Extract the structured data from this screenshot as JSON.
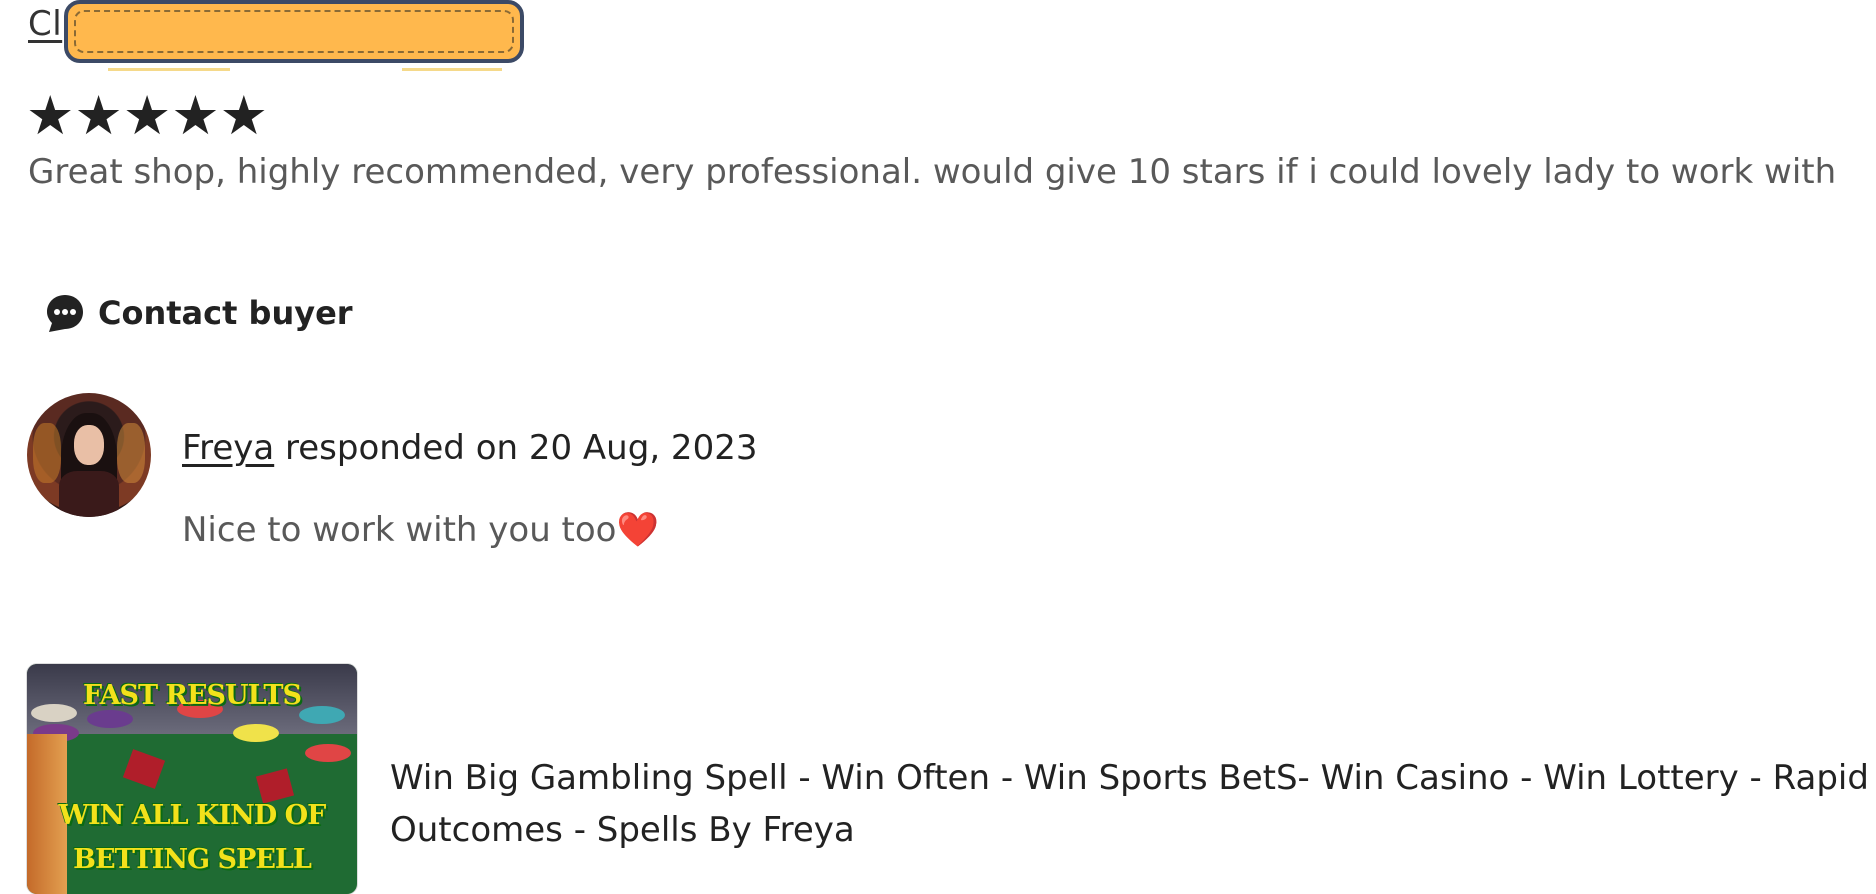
{
  "review": {
    "reviewer_name_visible": "Cl",
    "rating": 5,
    "stars": "★★★★★",
    "text": "Great shop, highly recommended, very professional. would give 10 stars if i could lovely lady to work with"
  },
  "contact": {
    "label": "Contact buyer",
    "icon": "chat-bubble-icon"
  },
  "response": {
    "seller_name": "Freya",
    "responded_text": " responded on 20 Aug, 2023",
    "message": "Nice to work with you too",
    "emoji": "❤️"
  },
  "listing": {
    "title": "Win Big Gambling Spell - Win Often - Win Sports BetS- Win Casino - Win Lottery - Rapid Outcomes - Spells By Freya",
    "thumbnail_text": [
      "FAST RESULTS",
      "WIN ALL KIND OF",
      "BETTING SPELL"
    ]
  },
  "colors": {
    "redaction": "#ffb84d",
    "redaction_border": "#3c4a66",
    "heart": "#d0021b",
    "muted_text": "#595959"
  }
}
